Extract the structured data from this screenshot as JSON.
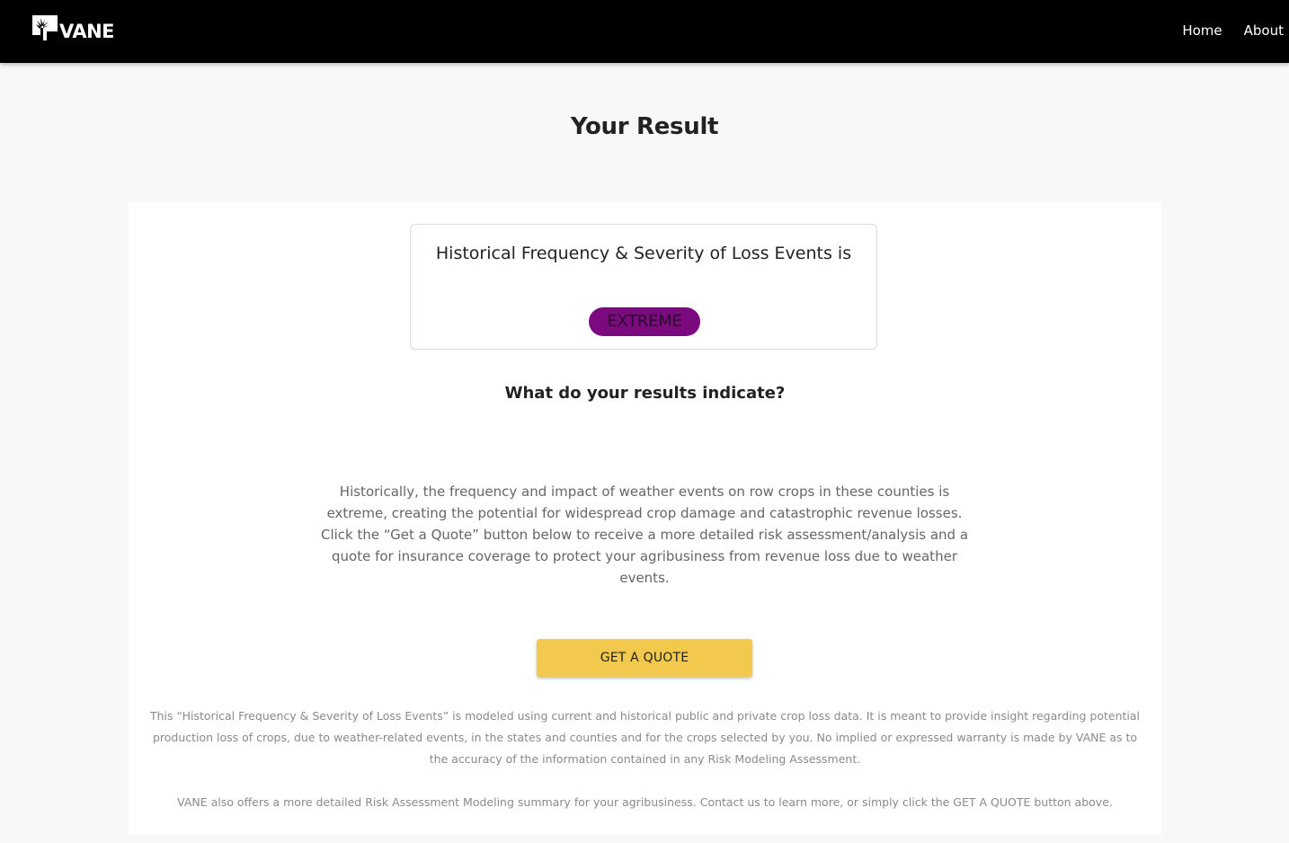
{
  "colors": {
    "header_bg": "#000000",
    "badge_bg": "#7b0a7e",
    "badge_text": "#2a0a2a",
    "button_bg": "#f2c94c"
  },
  "header": {
    "logo_text": "VANE",
    "logo_icon": "tree-icon",
    "nav": [
      {
        "label": "Home"
      },
      {
        "label": "About"
      }
    ]
  },
  "page": {
    "title": "Your Result"
  },
  "result": {
    "heading": "Historical Frequency & Severity of Loss Events is",
    "level": "EXTREME"
  },
  "explanation": {
    "heading": "What do your results indicate?",
    "paragraph1": "Historically, the frequency and impact of weather events on row crops in these counties is extreme, creating the potential for widespread crop damage and catastrophic revenue losses.",
    "paragraph2": "Click the “Get a Quote” button below to receive a more detailed risk assessment/analysis and a quote for insurance coverage to protect your agribusiness from revenue loss due to weather events."
  },
  "cta": {
    "label": "GET A QUOTE"
  },
  "disclaimer": {
    "paragraph1": "This “Historical Frequency & Severity of Loss Events” is modeled using current and historical public and private crop loss data. It is meant to provide insight regarding potential production loss of crops, due to weather-related events, in the states and counties and for the crops selected by you. No implied or expressed warranty is made by VANE as to the accuracy of the information contained in any Risk Modeling Assessment.",
    "paragraph2": "VANE also offers a more detailed Risk Assessment Modeling summary for your agribusiness. Contact us to learn more, or simply click the GET A QUOTE button above."
  }
}
